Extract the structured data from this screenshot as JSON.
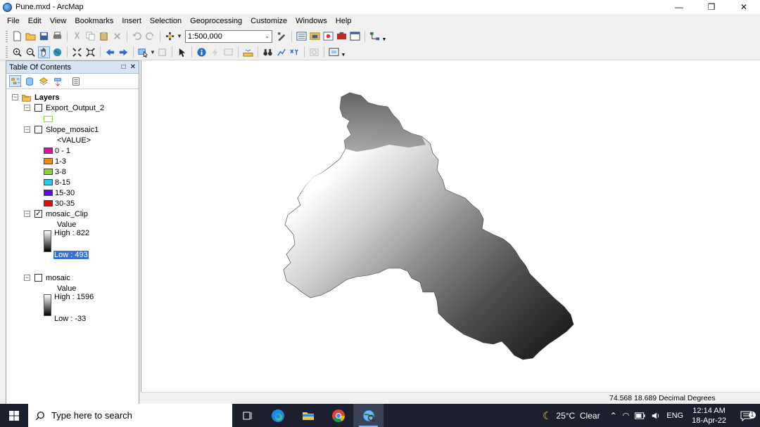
{
  "window": {
    "title": "Pune.mxd - ArcMap",
    "controls": [
      "minimize-icon",
      "restore-icon",
      "close-icon"
    ]
  },
  "menu": [
    "File",
    "Edit",
    "View",
    "Bookmarks",
    "Insert",
    "Selection",
    "Geoprocessing",
    "Customize",
    "Windows",
    "Help"
  ],
  "toolbar": {
    "scale_value": "1:500,000"
  },
  "toc": {
    "title": "Table Of Contents",
    "root_label": "Layers",
    "layers": {
      "export_output": {
        "name": "Export_Output_2",
        "checked": false
      },
      "slope_mosaic": {
        "name": "Slope_mosaic1",
        "checked": false,
        "field": "<VALUE>",
        "classes": [
          {
            "label": "0 - 1",
            "color": "#e60a9d"
          },
          {
            "label": "1-3",
            "color": "#f58a0a"
          },
          {
            "label": "3-8",
            "color": "#7ddc1f"
          },
          {
            "label": "8-15",
            "color": "#25c8ef"
          },
          {
            "label": "15-30",
            "color": "#5b0ae6"
          },
          {
            "label": "30-35",
            "color": "#e60a0a"
          }
        ]
      },
      "mosaic_clip": {
        "name": "mosaic_Clip",
        "checked": true,
        "value_label": "Value",
        "high": "High : 822",
        "low": "Low : 493"
      },
      "mosaic": {
        "name": "mosaic",
        "checked": false,
        "value_label": "Value",
        "high": "High : 1596",
        "low": "Low : -33"
      }
    }
  },
  "status": {
    "coordinates": "74.568  18.689 Decimal Degrees"
  },
  "taskbar": {
    "search_placeholder": "Type here to search",
    "weather": "25°C  Clear",
    "language": "ENG",
    "time": "12:14 AM",
    "date": "18-Apr-22",
    "notification_count": "1"
  }
}
